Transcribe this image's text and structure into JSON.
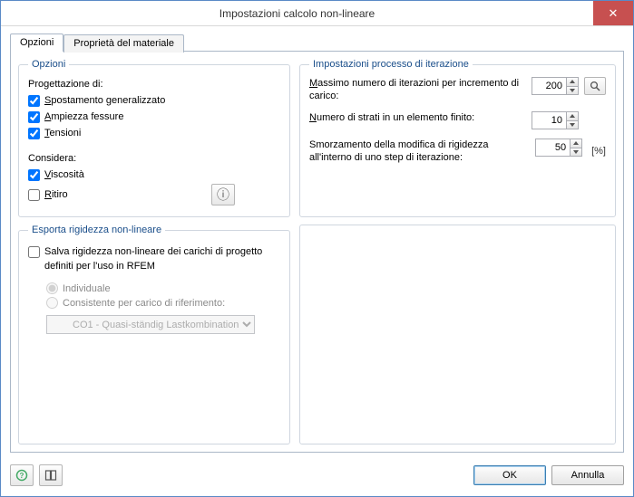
{
  "window": {
    "title": "Impostazioni calcolo non-lineare"
  },
  "tabs": {
    "options": "Opzioni",
    "material": "Proprietà del materiale"
  },
  "opzioni": {
    "legend": "Opzioni",
    "progettazione": "Progettazione di:",
    "spostamento": "Spostamento generalizzato",
    "ampiezza": "Ampiezza fessure",
    "tensioni": "Tensioni",
    "considera": "Considera:",
    "viscosita": "Viscosità",
    "ritiro": "Ritiro"
  },
  "iter": {
    "legend": "Impostazioni processo di iterazione",
    "maxiter_label": "Massimo numero di iterazioni per incremento di carico:",
    "maxiter_value": "200",
    "strati_label": "Numero di strati in un elemento finito:",
    "strati_value": "10",
    "smorz_label": "Smorzamento della modifica di rigidezza all'interno di uno step di iterazione:",
    "smorz_value": "50",
    "smorz_unit": "[%]"
  },
  "export": {
    "legend": "Esporta rigidezza non-lineare",
    "salva": "Salva rigidezza non-lineare dei carichi di progetto definiti per l'uso in RFEM",
    "individuale": "Individuale",
    "consistente": "Consistente per carico di riferimento:",
    "combo": "CO1 - Quasi-ständig Lastkombination"
  },
  "footer": {
    "ok": "OK",
    "cancel": "Annulla"
  },
  "icons": {
    "info": "ⓘ",
    "help": "?",
    "close": "✕"
  }
}
